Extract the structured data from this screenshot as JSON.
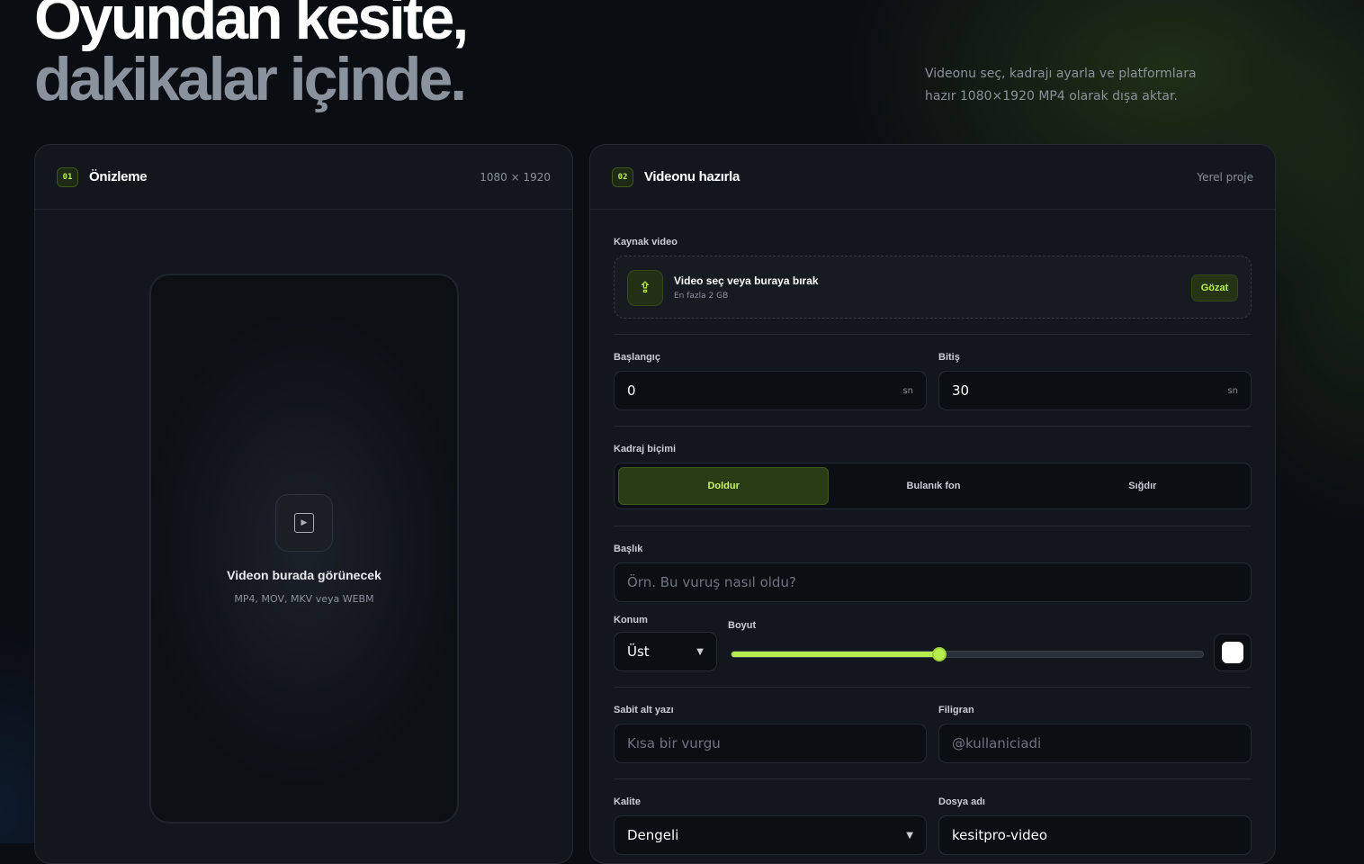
{
  "hero": {
    "title_line1": "Oyundan kesite,",
    "title_line2": "dakikalar içinde.",
    "subtitle": "Videonu seç, kadrajı ayarla ve platformlara hazır 1080×1920 MP4 olarak dışa aktar."
  },
  "preview": {
    "number": "01",
    "title": "Önizleme",
    "resolution": "1080 × 1920",
    "placeholder_icon": "play-icon",
    "placeholder_title": "Videon burada görünecek",
    "placeholder_formats": "MP4, MOV, MKV veya WEBM"
  },
  "editor": {
    "number": "02",
    "title": "Videonu hazırla",
    "meta": "Yerel proje",
    "source": {
      "label": "Kaynak video",
      "icon": "upload-icon",
      "drop_title": "Video seç veya buraya bırak",
      "drop_sub": "En fazla 2 GB",
      "browse_label": "Gözat"
    },
    "start": {
      "label": "Başlangıç",
      "value": "0",
      "unit": "sn"
    },
    "end": {
      "label": "Bitiş",
      "value": "30",
      "unit": "sn"
    },
    "frame": {
      "label": "Kadraj biçimi",
      "options": [
        "Doldur",
        "Bulanık fon",
        "Sığdır"
      ],
      "selected": "Doldur"
    },
    "headline": {
      "label": "Başlık",
      "placeholder": "Örn. Bu vuruş nasıl oldu?"
    },
    "position": {
      "label": "Konum",
      "value": "Üst"
    },
    "size": {
      "label": "Boyut",
      "level": 0.44
    },
    "text_color": "#ffffff",
    "caption": {
      "label": "Sabit alt yazı",
      "placeholder": "Kısa bir vurgu"
    },
    "watermark": {
      "label": "Filigran",
      "placeholder": "@kullaniciadi"
    },
    "quality": {
      "label": "Kalite",
      "value": "Dengeli"
    },
    "filename": {
      "label": "Dosya adı",
      "value": "kesitpro-video"
    }
  },
  "colors": {
    "accent": "#b7ee4f",
    "background": "#0a0d12",
    "card": "#12161d"
  }
}
